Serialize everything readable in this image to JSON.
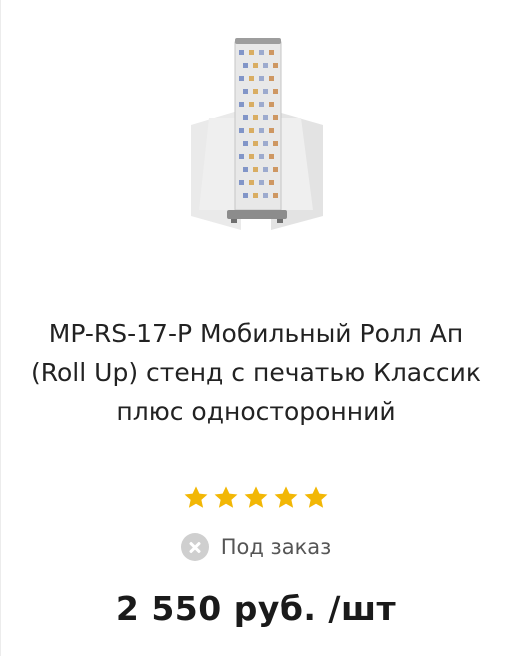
{
  "product": {
    "image_alt": "MP-RS-17-P roll up stand",
    "title": "MP-RS-17-P Мобильный Ролл Ап (Roll Up) стенд с печатью Классик плюс односторонний",
    "rating": 5,
    "rating_max": 5,
    "availability": "Под заказ",
    "availability_icon": "close-circle-icon",
    "price": "2 550 руб. /шт"
  },
  "colors": {
    "star": "#f2b705",
    "status_icon": "#cfcfcf",
    "price": "#1a1a1a"
  }
}
